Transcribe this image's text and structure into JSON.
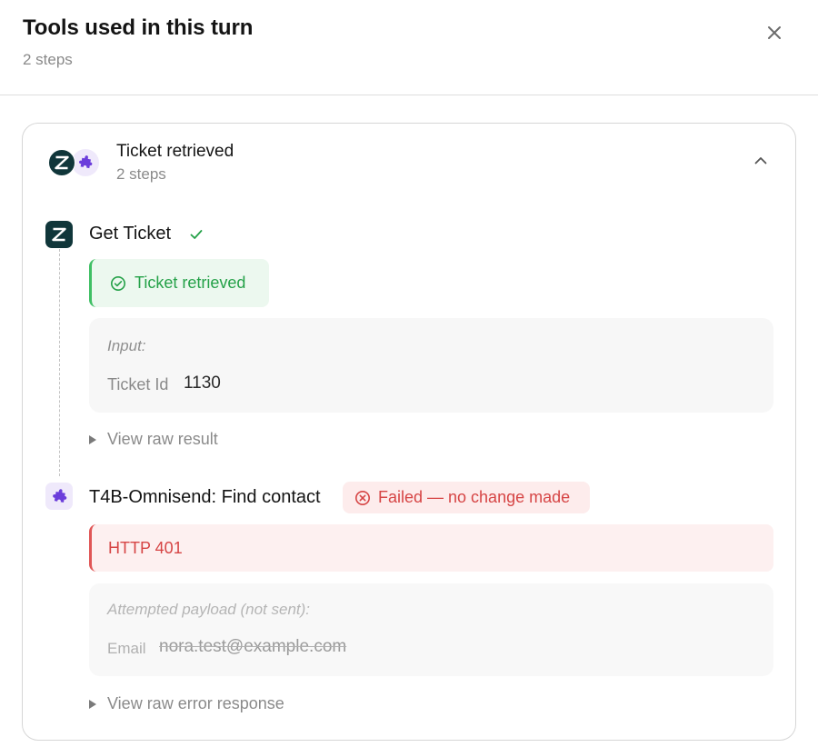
{
  "header": {
    "title": "Tools used in this turn",
    "subtitle": "2 steps"
  },
  "card": {
    "title": "Ticket retrieved",
    "subtitle": "2 steps",
    "steps": [
      {
        "title": "Get Ticket",
        "status": "success",
        "status_label": "Ticket retrieved",
        "input_label": "Input:",
        "input_key": "Ticket Id",
        "input_value": "1130",
        "raw_link": "View raw result"
      },
      {
        "title": "T4B-Omnisend: Find contact",
        "status": "failed",
        "status_label": "Failed — no change made",
        "error": "HTTP 401",
        "payload_label": "Attempted payload (not sent):",
        "payload_key": "Email",
        "payload_value": "nora.test@example.com",
        "raw_link": "View raw error response"
      }
    ]
  },
  "icons": {
    "close": "close-icon",
    "chevron": "chevron-up-icon",
    "zendesk": "zendesk-logo-icon",
    "puzzle": "puzzle-piece-icon",
    "check": "check-icon",
    "check_circle": "check-circle-icon",
    "x_circle": "x-circle-icon"
  },
  "colors": {
    "zendesk_bg": "#10363a",
    "puzzle_bg": "#efe9fb",
    "puzzle_fg": "#6b3ddb",
    "success": "#24a148",
    "success_bg": "#ecf8ef",
    "error": "#d64545",
    "error_bg": "#fdf0f0"
  }
}
